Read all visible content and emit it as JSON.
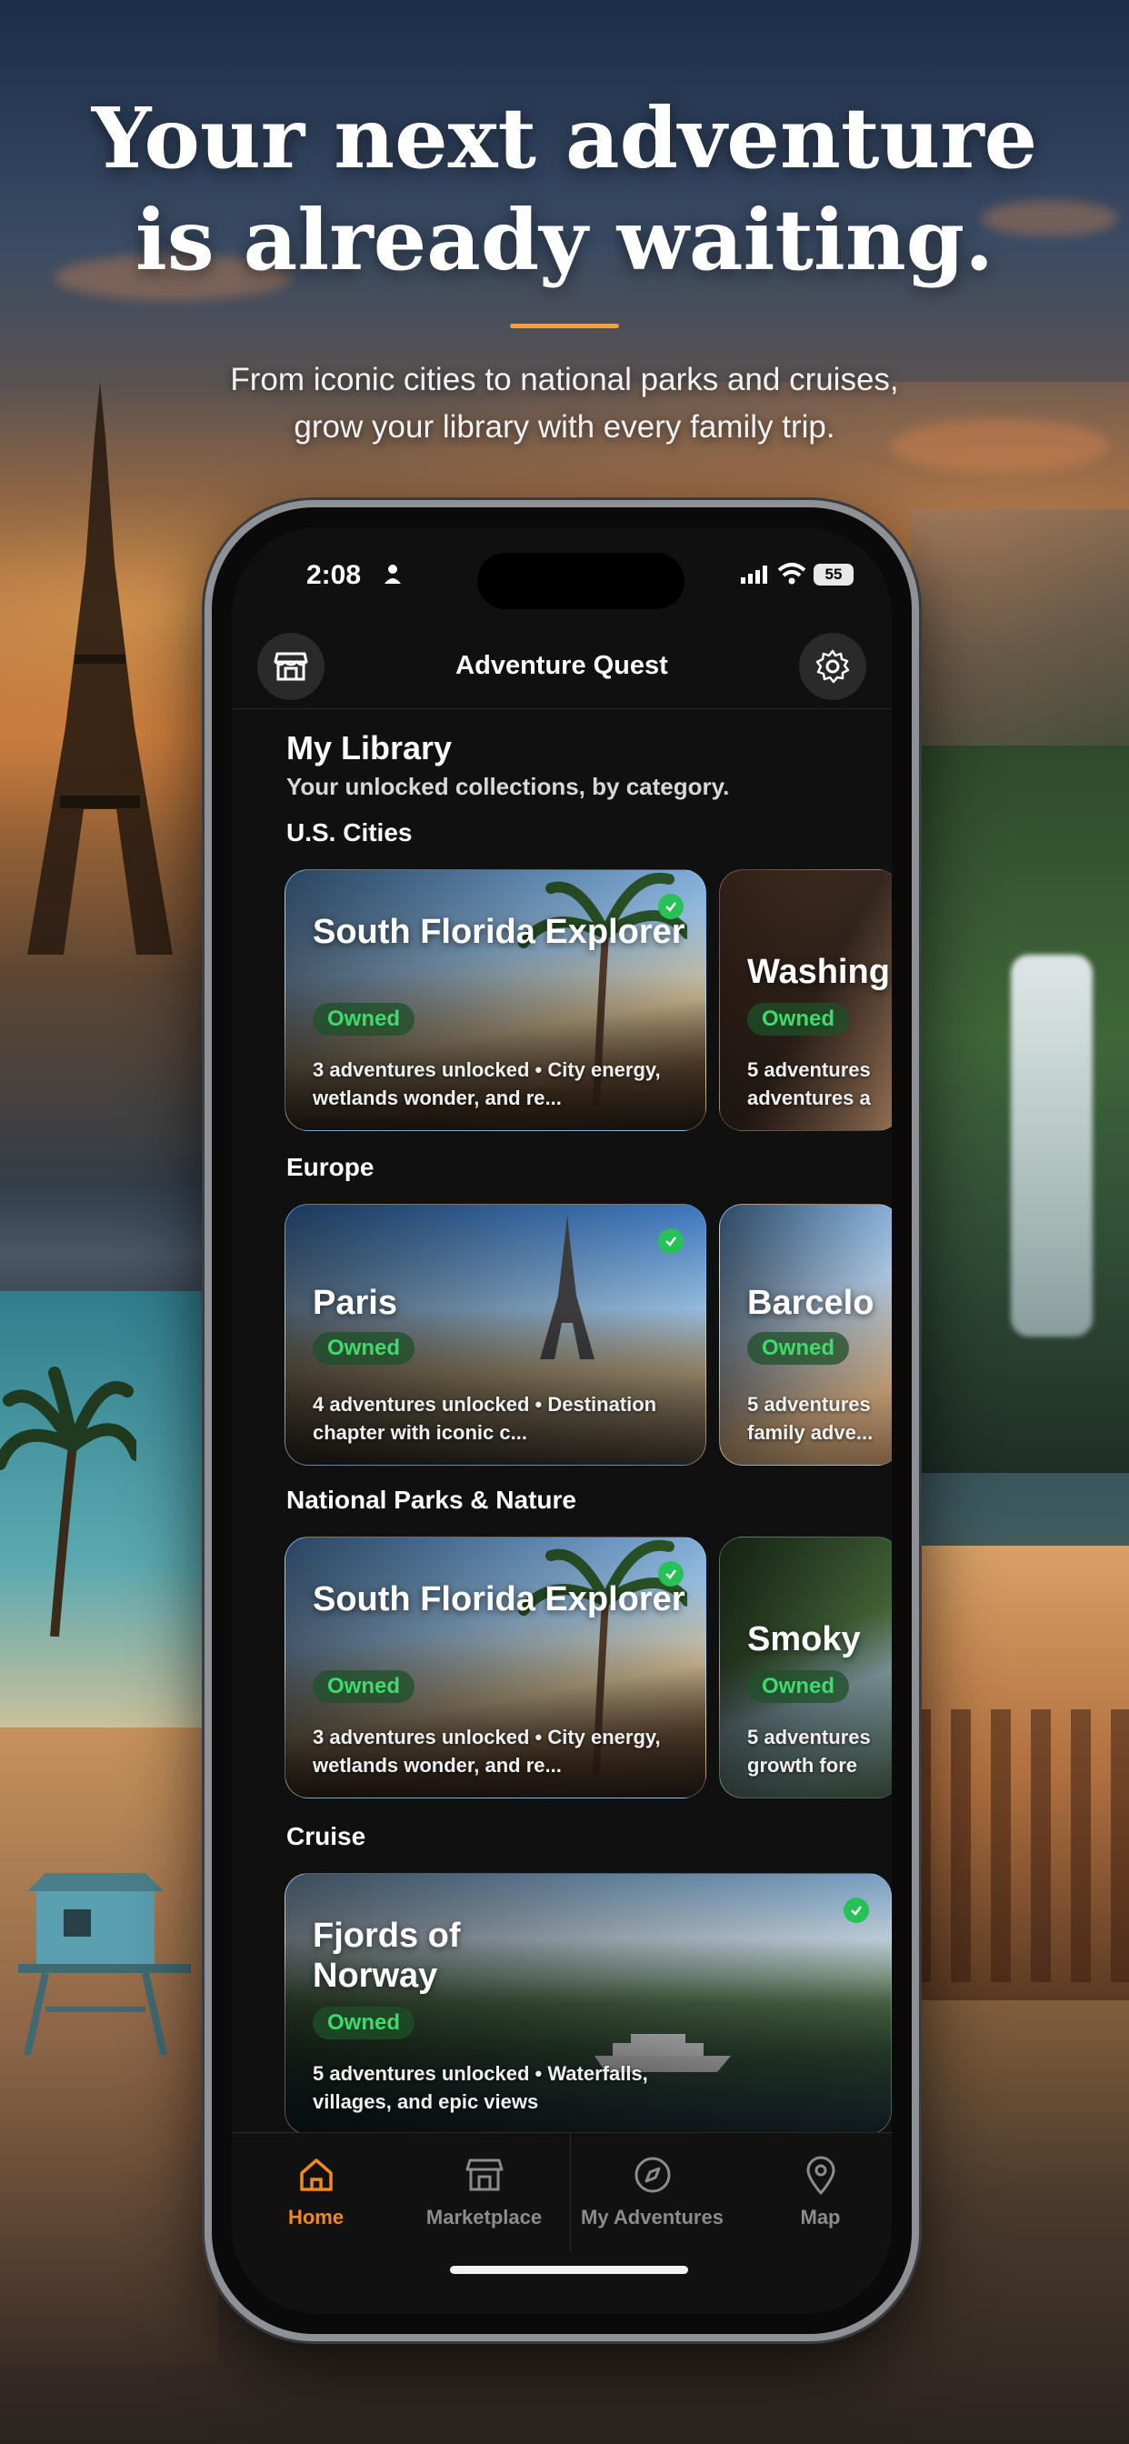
{
  "hero": {
    "headline_line1": "Your next adventure",
    "headline_line2": "is already waiting.",
    "subhead_line1": "From iconic cities to national parks and cruises,",
    "subhead_line2": "grow your library with every family trip.",
    "accent_color": "#f0a040"
  },
  "status_bar": {
    "time": "2:08",
    "battery": "55"
  },
  "app": {
    "title": "Adventure Quest",
    "left_icon": "storefront-icon",
    "right_icon": "gear-icon"
  },
  "library": {
    "title": "My Library",
    "subtitle": "Your unlocked collections, by category.",
    "owned_label": "Owned",
    "owned_color": "#3ddc6a",
    "sections": [
      {
        "label": "U.S. Cities",
        "cards": [
          {
            "title": "South Florida Explorer",
            "desc": "3 adventures unlocked • City energy, wetlands wonder, and re...",
            "checked": true
          },
          {
            "title": "Washing",
            "desc": "5 adventures adventures a",
            "checked": false
          }
        ]
      },
      {
        "label": "Europe",
        "cards": [
          {
            "title": "Paris",
            "desc": "4 adventures unlocked • Destination chapter with iconic c...",
            "checked": true
          },
          {
            "title": "Barcelo",
            "desc": "5 adventures family adve...",
            "checked": false
          }
        ]
      },
      {
        "label": "National Parks & Nature",
        "cards": [
          {
            "title": "South Florida Explorer",
            "desc": "3 adventures unlocked • City energy, wetlands wonder, and re...",
            "checked": true
          },
          {
            "title": "Smoky",
            "desc": "5 adventures growth fore",
            "checked": false
          }
        ]
      },
      {
        "label": "Cruise",
        "cards": [
          {
            "title": "Fjords of Norway",
            "desc": "5 adventures unlocked • Waterfalls, villages, and epic views",
            "checked": true
          }
        ]
      }
    ]
  },
  "tabs": [
    {
      "label": "Home",
      "icon": "home-icon",
      "active": true
    },
    {
      "label": "Marketplace",
      "icon": "storefront-icon",
      "active": false
    },
    {
      "label": "My Adventures",
      "icon": "compass-icon",
      "active": false
    },
    {
      "label": "Map",
      "icon": "map-pin-icon",
      "active": false
    }
  ],
  "active_tab_color": "#f08a1c"
}
